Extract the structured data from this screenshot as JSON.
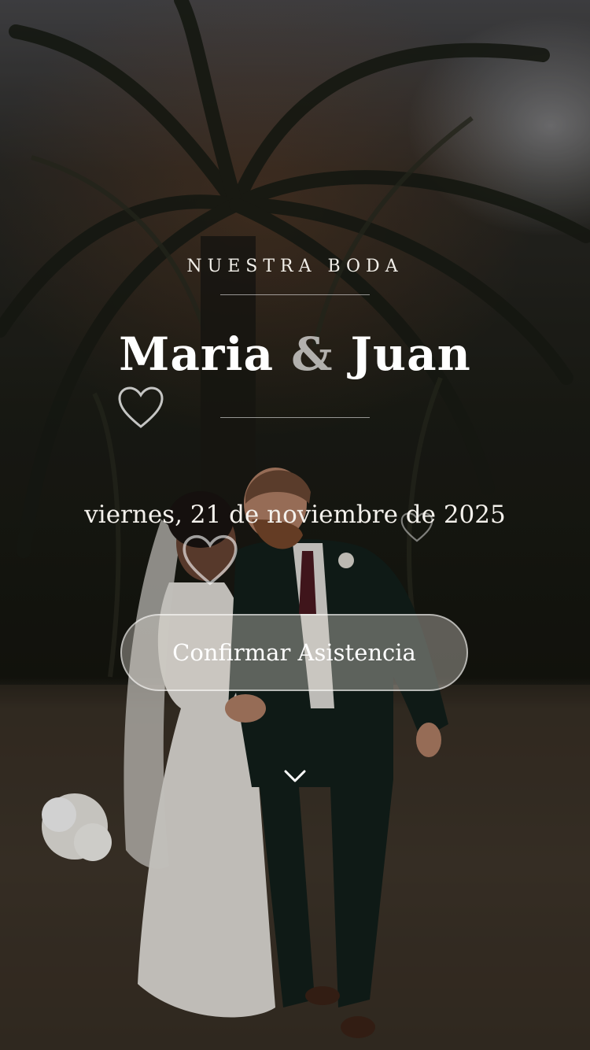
{
  "hero": {
    "eyebrow": "NUESTRA BODA",
    "groom_bride": {
      "name_1": "Maria",
      "ampersand": "&",
      "name_2": "Juan"
    },
    "date": "viernes, 21 de noviembre de 2025",
    "rsvp_label": "Confirmar Asistencia",
    "decorative_icons": [
      "heart-outline-icon",
      "heart-outline-icon",
      "heart-outline-icon"
    ],
    "scroll_icon": "chevron-down-icon"
  },
  "colors": {
    "text_primary": "#ffffff",
    "ampersand": "#c8c6c2",
    "button_fill": "rgba(220,215,208,0.38)",
    "button_border": "rgba(255,255,255,0.55)"
  }
}
